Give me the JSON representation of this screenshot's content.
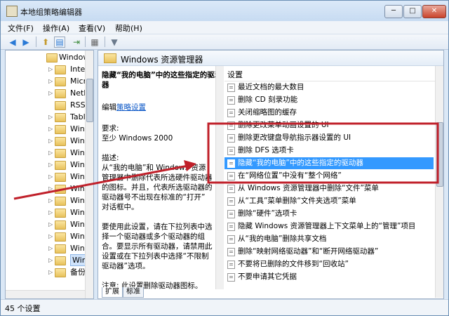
{
  "window": {
    "title": "本地组策略编辑器",
    "buttons": {
      "minimize": "─",
      "maximize": "□",
      "close": "✕"
    }
  },
  "menu": [
    "文件(F)",
    "操作(A)",
    "查看(V)",
    "帮助(H)"
  ],
  "toolbar": {
    "icons": [
      "back-arrow-icon",
      "forward-arrow-icon",
      "folder-up-icon",
      "show-hide-tree-icon",
      "export-list-icon",
      "properties-icon",
      "filter-icon"
    ],
    "glyphs": {
      "back": "◀",
      "forward": "▶",
      "up": "⬆",
      "tree": "▤",
      "export": "⇥",
      "props": "▦",
      "filter": "▼"
    }
  },
  "tree": {
    "items": [
      "Windows",
      "Intern",
      "Micro",
      "NetM",
      "RSS 源",
      "Tablet",
      "Windo",
      "Windo",
      "Windo",
      "Windo",
      "Windo",
      "Windo",
      "Windo",
      "Windo",
      "Windo",
      "Windo",
      "Windo",
      "Windo",
      "备份"
    ],
    "expand_glyph": "▷",
    "open_glyph": "◢"
  },
  "pane": {
    "header": "Windows 资源管理器",
    "description": {
      "title_line1": "隐藏“我的电脑”中的这些指定的驱动",
      "title_line2": "器",
      "edit_prefix": "编辑",
      "edit_link": "策略设置",
      "requirements_label": "要求:",
      "requirements_value": "至少 Windows 2000",
      "desc_label": "描述:",
      "desc_lines": [
        "从“我的电脑”和 Windows 资源",
        "管理器中删除代表所选硬件驱动器",
        "的图标。并且，代表所选驱动器的",
        "驱动器号不出现在标准的“打开”",
        "对话框中。",
        "",
        "要使用此设置，请在下拉列表中选",
        "择一个驱动器或多个驱动器的组",
        "合。要显示所有驱动器，请禁用此",
        "设置或在下拉列表中选择“不限制",
        "驱动器”选项。",
        "",
        "注意: 此设置删除驱动器图标。"
      ]
    },
    "list_header": "设置",
    "settings": [
      "最近文档的最大数目",
      "删除 CD 刻录功能",
      "关闭缩略图的缓存",
      "删除更改菜单动画设置的 UI",
      "删除更改键盘导航指示器设置的 UI",
      "删除 DFS 选项卡",
      "隐藏“我的电脑”中的这些指定的驱动器",
      "在“网络位置”中没有“整个网络”",
      "从 Windows 资源管理器中删除“文件”菜单",
      "从“工具”菜单删除“文件夹选项”菜单",
      "删除“硬件”选项卡",
      "隐藏 Windows 资源管理器上下文菜单上的“管理”项目",
      "从“我的电脑”删除共享文档",
      "删除“映射网络驱动器”和“断开网络驱动器”",
      "不要将已删除的文件移到“回收站”",
      "不要申请其它凭据"
    ],
    "selected_index": 6,
    "tabs": [
      "扩展",
      "标准"
    ]
  },
  "status": "45 个设置",
  "annotation": {
    "color": "#c0202a"
  }
}
